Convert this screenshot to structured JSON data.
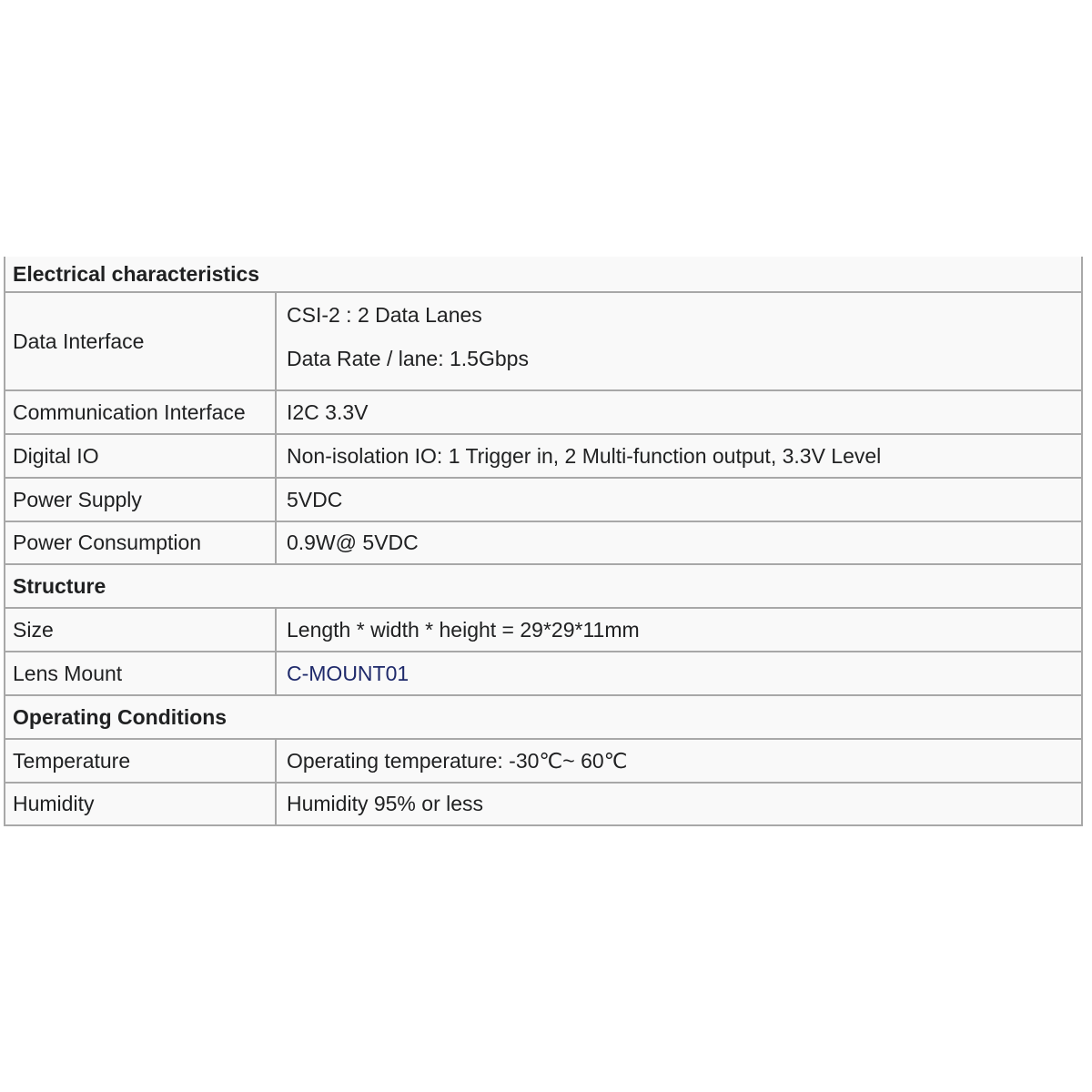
{
  "colors": {
    "border": "#a8a8a8",
    "text": "#202122",
    "table_background": "#f9f9f9",
    "link_text": "#1f2a6b"
  },
  "table": {
    "sections": [
      {
        "heading": "Electrical characteristics",
        "rows": [
          {
            "label": "Data Interface",
            "values": [
              "CSI-2 : 2 Data Lanes",
              "Data Rate / lane: 1.5Gbps"
            ]
          },
          {
            "label": "Communication Interface",
            "value": "I2C 3.3V"
          },
          {
            "label": "Digital IO",
            "value": "Non-isolation IO: 1 Trigger in, 2 Multi-function output, 3.3V Level"
          },
          {
            "label": "Power Supply",
            "value": "5VDC"
          },
          {
            "label": "Power Consumption",
            "value": "0.9W@ 5VDC"
          }
        ]
      },
      {
        "heading": "Structure",
        "rows": [
          {
            "label": "Size",
            "value": "Length * width * height = 29*29*11mm"
          },
          {
            "label": "Lens Mount",
            "value": "C-MOUNT01"
          }
        ]
      },
      {
        "heading": "Operating Conditions",
        "rows": [
          {
            "label": "Temperature",
            "value": "Operating temperature: -30℃~ 60℃"
          },
          {
            "label": "Humidity",
            "value": "Humidity 95% or less"
          }
        ]
      }
    ]
  }
}
